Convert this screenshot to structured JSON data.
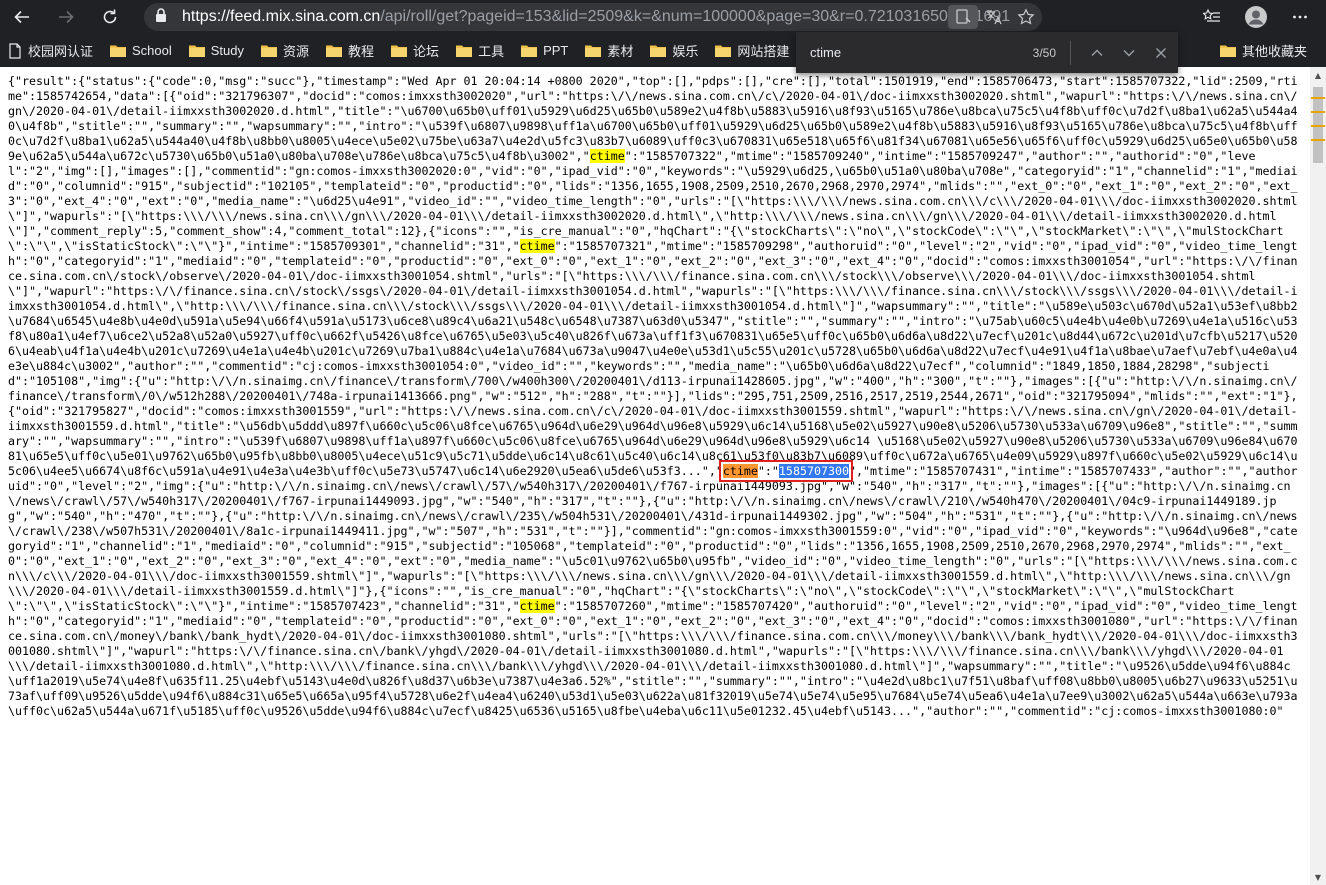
{
  "browser": {
    "url_base": "https://feed.mix.sina.com.cn",
    "url_rest": "/api/roll/get?pageid=153&lid=2509&k=&num=100000&page=30&r=0.7210316507361691"
  },
  "bookmarks": {
    "items": [
      {
        "label": "校园网认证",
        "icon": "page-icon"
      },
      {
        "label": "School",
        "icon": "folder-icon"
      },
      {
        "label": "Study",
        "icon": "folder-icon"
      },
      {
        "label": "资源",
        "icon": "folder-icon"
      },
      {
        "label": "教程",
        "icon": "folder-icon"
      },
      {
        "label": "论坛",
        "icon": "folder-icon"
      },
      {
        "label": "工具",
        "icon": "folder-icon"
      },
      {
        "label": "PPT",
        "icon": "folder-icon"
      },
      {
        "label": "素材",
        "icon": "folder-icon"
      },
      {
        "label": "娱乐",
        "icon": "folder-icon"
      },
      {
        "label": "网站搭建",
        "icon": "folder-icon"
      }
    ],
    "other": "其他收藏夹"
  },
  "find": {
    "query": "ctime",
    "count": "3/50"
  },
  "content": {
    "segments": [
      {
        "t": "{\"result\":{\"status\":{\"code\":0,\"msg\":\"succ\"},\"timestamp\":\"Wed Apr 01 20:04:14 +0800 2020\",\"top\":[],\"pdps\":[],\"cre\":[],\"total\":1501919,\"end\":1585706473,\"start\":1585707322,\"lid\":2509,\"rtime\":1585742654,\"data\":[{\"oid\":\"321796307\",\"docid\":\"comos:imxxsth3002020\",\"url\":\"https:\\/\\/news.sina.com.cn\\/c\\/2020-04-01\\/doc-iimxxsth3002020.shtml\",\"wapurl\":\"https:\\/\\/news.sina.cn\\/gn\\/2020-04-01\\/detail-iimxxsth3002020.d.html\",\"title\":\"\\u6700\\u65b0\\uff01\\u5929\\u6d25\\u65b0\\u589e2\\u4f8b\\u5883\\u5916\\u8f93\\u5165\\u786e\\u8bca\\u75c5\\u4f8b\\uff0c\\u7d2f\\u8ba1\\u62a5\\u544a40\\u4f8b\",\"stitle\":\"\",\"summary\":\"\",\"wapsummary\":\"\",\"intro\":\"\\u539f\\u6807\\u9898\\uff1a\\u6700\\u65b0\\uff01\\u5929\\u6d25\\u65b0\\u589e2\\u4f8b\\u5883\\u5916\\u8f93\\u5165\\u786e\\u8bca\\u75c5\\u4f8b\\uff0c\\u7d2f\\u8ba1\\u62a5\\u544a40\\u4f8b\\u8bb0\\u8005\\u4ece\\u5e02\\u75be\\u63a7\\u4e2d\\u5fc3\\u83b7\\u6089\\uff0c3\\u670831\\u65e518\\u65f6\\u81f34\\u67081\\u65e56\\u65f6\\uff0c\\u5929\\u6d25\\u65e0\\u65b0\\u589e\\u62a5\\u544a\\u672c\\u5730\\u65b0\\u51a0\\u80ba\\u708e\\u786e\\u8bca\\u75c5\\u4f8b\\u3002\",\"",
        "k": "n"
      },
      {
        "t": "ctime",
        "k": "hl"
      },
      {
        "t": "\":\"1585707322\",\"mtime\":\"1585709240\",\"intime\":\"1585709247\",\"author\":\"\",\"authorid\":\"0\",\"level\":\"2\",\"img\":[],\"images\":[],\"commentid\":\"gn:comos-imxxsth3002020:0\",\"vid\":\"0\",\"ipad_vid\":\"0\",\"keywords\":\"\\u5929\\u6d25,\\u65b0\\u51a0\\u80ba\\u708e\",\"categoryid\":\"1\",\"channelid\":\"1\",\"mediaid\":\"0\",\"columnid\":\"915\",\"subjectid\":\"102105\",\"templateid\":\"0\",\"productid\":\"0\",\"lids\":\"1356,1655,1908,2509,2510,2670,2968,2970,2974\",\"mlids\":\"\",\"ext_0\":\"0\",\"ext_1\":\"0\",\"ext_2\":\"0\",\"ext_3\":\"0\",\"ext_4\":\"0\",\"ext\":\"0\",\"media_name\":\"\\u6d25\\u4e91\",\"video_id\":\"\",\"video_time_length\":\"0\",\"urls\":\"[\\\"https:\\\\\\/\\\\\\/news.sina.com.cn\\\\\\/c\\\\\\/2020-04-01\\\\\\/doc-iimxxsth3002020.shtml\\\"]\",\"wapurls\":\"[\\\"https:\\\\\\/\\\\\\/news.sina.cn\\\\\\/gn\\\\\\/2020-04-01\\\\\\/detail-iimxxsth3002020.d.html\\\",\\\"http:\\\\\\/\\\\\\/news.sina.cn\\\\\\/gn\\\\\\/2020-04-01\\\\\\/detail-iimxxsth3002020.d.html\\\"]\",\"comment_reply\":5,\"comment_show\":4,\"comment_total\":12},{\"icons\":\"\",\"is_cre_manual\":\"0\",\"hqChart\":\"{\\\"stockCharts\\\":\\\"no\\\",\\\"stockCode\\\":\\\"\\\",\\\"stockMarket\\\":\\\"\\\",\\\"mulStockChart\\\":\\\"\\\",\\\"isStaticStock\\\":\\\"\\\"}\",\"intime\":\"1585709301\",\"channelid\":\"31\",\"",
        "k": "n"
      },
      {
        "t": "ctime",
        "k": "hl"
      },
      {
        "t": "\":\"1585707321\",\"mtime\":\"1585709298\",\"authoruid\":\"0\",\"level\":\"2\",\"vid\":\"0\",\"ipad_vid\":\"0\",\"video_time_length\":\"0\",\"categoryid\":\"1\",\"mediaid\":\"0\",\"templateid\":\"0\",\"productid\":\"0\",\"ext_0\":\"0\",\"ext_1\":\"0\",\"ext_2\":\"0\",\"ext_3\":\"0\",\"ext_4\":\"0\",\"docid\":\"comos:imxxsth3001054\",\"url\":\"https:\\/\\/finance.sina.com.cn\\/stock\\/observe\\/2020-04-01\\/doc-iimxxsth3001054.shtml\",\"urls\":\"[\\\"https:\\\\\\/\\\\\\/finance.sina.com.cn\\\\\\/stock\\\\\\/observe\\\\\\/2020-04-01\\\\\\/doc-iimxxsth3001054.shtml\\\"]\",\"wapurl\":\"https:\\/\\/finance.sina.cn\\/stock\\/ssgs\\/2020-04-01\\/detail-iimxxsth3001054.d.html\",\"wapurls\":\"[\\\"https:\\\\\\/\\\\\\/finance.sina.cn\\\\\\/stock\\\\\\/ssgs\\\\\\/2020-04-01\\\\\\/detail-iimxxsth3001054.d.html\\\",\\\"http:\\\\\\/\\\\\\/finance.sina.cn\\\\\\/stock\\\\\\/ssgs\\\\\\/2020-04-01\\\\\\/detail-iimxxsth3001054.d.html\\\"]\",\"wapsummary\":\"\",\"title\":\"\\u589e\\u503c\\u670d\\u52a1\\u53ef\\u8bb2\\u7684\\u6545\\u4e8b\\u4e0d\\u591a\\u5e94\\u66f4\\u591a\\u5173\\u6ce8\\u89c4\\u6a21\\u548c\\u6548\\u7387\\u63d0\\u5347\",\"stitle\":\"\",\"summary\":\"\",\"intro\":\"\\u75ab\\u60c5\\u4e4b\\u4e0b\\u7269\\u4e1a\\u516c\\u53f8\\u80a1\\u4ef7\\u6ce2\\u52a8\\u52a0\\u5927\\uff0c\\u662f\\u5426\\u8fce\\u6765\\u5e03\\u5c40\\u826f\\u673a\\uff1f3\\u670831\\u65e5\\uff0c\\u65b0\\u6d6a\\u8d22\\u7ecf\\u201c\\u8d44\\u672c\\u201d\\u7cfb\\u5217\\u5206\\u4eab\\u4f1a\\u4e4b\\u201c\\u7269\\u4e1a\\u4e4b\\u201c\\u7269\\u7ba1\\u884c\\u4e1a\\u7684\\u673a\\u9047\\u4e0e\\u53d1\\u5c55\\u201c\\u5728\\u65b0\\u6d6a\\u8d22\\u7ecf\\u4e91\\u4f1a\\u8bae\\u7aef\\u7ebf\\u4e0a\\u4e3e\\u884c\\u3002\",\"author\":\"\",\"commentid\":\"cj:comos-imxxsth3001054:0\",\"video_id\":\"\",\"keywords\":\"\",\"media_name\":\"\\u65b0\\u6d6a\\u8d22\\u7ecf\",\"columnid\":\"1849,1850,1884,28298\",\"subjectid\":\"105108\",\"img\":{\"u\":\"http:\\/\\/n.sinaimg.cn\\/finance\\/transform\\/700\\/w400h300\\/20200401\\/d113-irpunai1428605.jpg\",\"w\":\"400\",\"h\":\"300\",\"t\":\"\"},\"images\":[{\"u\":\"http:\\/\\/n.sinaimg.cn\\/finance\\/transform\\/0\\/w512h288\\/20200401\\/748a-irpunai1413666.png\",\"w\":\"512\",\"h\":\"288\",\"t\":\"\"}],\"lids\":\"295,751,2509,2516,2517,2519,2544,2671\",\"oid\":\"321795094\",\"mlids\":\"\",\"ext\":\"1\"},{\"oid\":\"321795827\",\"docid\":\"comos:imxxsth3001559\",\"url\":\"https:\\/\\/news.sina.com.cn\\/c\\/2020-04-01\\/doc-iimxxsth3001559.shtml\",\"wapurl\":\"https:\\/\\/news.sina.cn\\/gn\\/2020-04-01\\/detail-iimxxsth3001559.d.html\",\"title\":\"\\u56db\\u5ddd\\u897f\\u660c\\u5c06\\u8fce\\u6765\\u964d\\u6e29\\u964d\\u96e8\\u5929\\u6c14\\u5168\\u5e02\\u5927\\u90e8\\u5206\\u5730\\u533a\\u6709\\u96e8\",\"stitle\":\"\",\"summary\":\"\",\"wapsummary\":\"\",\"intro\":\"\\u539f\\u6807\\u9898\\uff1a\\u897f\\u660c\\u5c06\\u8fce\\u6765\\u964d\\u6e29\\u964d\\u96e8\\u5929\\u6c14 \\u5168\\u5e02\\u5927\\u90e8\\u5206\\u5730\\u533a\\u6709\\u96e84\\u67081\\u65e5\\uff0c\\u5e01\\u9762\\u65b0\\u95fb\\u8bb0\\u8005\\u4ece\\u51c9\\u5c71\\u5dde\\u6c14\\u8c61\\u5c40\\u6c14\\u8c61\\u53f0\\u83b7\\u6089\\uff0c\\u672a\\u6765\\u4e09\\u5929\\u897f\\u660c\\u5e02\\u5929\\u6c14\\u5c06\\u4ee5\\u6674\\u8f6c\\u591a\\u4e91\\u4e3a\\u4e3b\\uff0c\\u5e73\\u5747\\u6c14\\u6e2920\\u5ea6\\u5de6\\u53f3...\",\"",
        "k": "n"
      },
      {
        "t": "ctime",
        "k": "cur"
      },
      {
        "t": "\":\"",
        "k": "box"
      },
      {
        "t": "1585707300",
        "k": "sel"
      },
      {
        "t": "\",\"mtime\":\"1585707431\",\"intime\":\"1585707433\",\"author\":\"\",\"authoruid\":\"0\",\"level\":\"2\",\"img\":{\"u\":\"http:\\/\\/n.sinaimg.cn\\/news\\/crawl\\/57\\/w540h317\\/20200401\\/f767-irpunai1449093.jpg\",\"w\":\"540\",\"h\":\"317\",\"t\":\"\"},\"images\":[{\"u\":\"http:\\/\\/n.sinaimg.cn\\/news\\/crawl\\/57\\/w540h317\\/20200401\\/f767-irpunai1449093.jpg\",\"w\":\"540\",\"h\":\"317\",\"t\":\"\"},{\"u\":\"http:\\/\\/n.sinaimg.cn\\/news\\/crawl\\/210\\/w540h470\\/20200401\\/04c9-irpunai1449189.jpg\",\"w\":\"540\",\"h\":\"470\",\"t\":\"\"},{\"u\":\"http:\\/\\/n.sinaimg.cn\\/news\\/crawl\\/235\\/w504h531\\/20200401\\/431d-irpunai1449302.jpg\",\"w\":\"504\",\"h\":\"531\",\"t\":\"\"},{\"u\":\"http:\\/\\/n.sinaimg.cn\\/news\\/crawl\\/238\\/w507h531\\/20200401\\/8a1c-irpunai1449411.jpg\",\"w\":\"507\",\"h\":\"531\",\"t\":\"\"}],\"commentid\":\"gn:comos-imxxsth3001559:0\",\"vid\":\"0\",\"ipad_vid\":\"0\",\"keywords\":\"\\u964d\\u96e8\",\"categoryid\":\"1\",\"channelid\":\"1\",\"mediaid\":\"0\",\"columnid\":\"915\",\"subjectid\":\"105068\",\"templateid\":\"0\",\"productid\":\"0\",\"lids\":\"1356,1655,1908,2509,2510,2670,2968,2970,2974\",\"mlids\":\"\",\"ext_0\":\"0\",\"ext_1\":\"0\",\"ext_2\":\"0\",\"ext_3\":\"0\",\"ext_4\":\"0\",\"ext\":\"0\",\"media_name\":\"\\u5c01\\u9762\\u65b0\\u95fb\",\"video_id\":\"0\",\"video_time_length\":\"0\",\"urls\":\"[\\\"https:\\\\\\/\\\\\\/news.sina.com.cn\\\\\\/c\\\\\\/2020-04-01\\\\\\/doc-iimxxsth3001559.shtml\\\"]\",\"wapurls\":\"[\\\"https:\\\\\\/\\\\\\/news.sina.cn\\\\\\/gn\\\\\\/2020-04-01\\\\\\/detail-iimxxsth3001559.d.html\\\",\\\"http:\\\\\\/\\\\\\/news.sina.cn\\\\\\/gn\\\\\\/2020-04-01\\\\\\/detail-iimxxsth3001559.d.html\\\"]\"},{\"icons\":\"\",\"is_cre_manual\":\"0\",\"hqChart\":\"{\\\"stockCharts\\\":\\\"no\\\",\\\"stockCode\\\":\\\"\\\",\\\"stockMarket\\\":\\\"\\\",\\\"mulStockChart\\\":\\\"\\\",\\\"isStaticStock\\\":\\\"\\\"}\",\"intime\":\"1585707423\",\"channelid\":\"31\",\"",
        "k": "n"
      },
      {
        "t": "ctime",
        "k": "hl"
      },
      {
        "t": "\":\"1585707260\",\"mtime\":\"1585707420\",\"authoruid\":\"0\",\"level\":\"2\",\"vid\":\"0\",\"ipad_vid\":\"0\",\"video_time_length\":\"0\",\"categoryid\":\"1\",\"mediaid\":\"0\",\"templateid\":\"0\",\"productid\":\"0\",\"ext_0\":\"0\",\"ext_1\":\"0\",\"ext_2\":\"0\",\"ext_3\":\"0\",\"ext_4\":\"0\",\"docid\":\"comos:imxxsth3001080\",\"url\":\"https:\\/\\/finance.sina.com.cn\\/money\\/bank\\/bank_hydt\\/2020-04-01\\/doc-iimxxsth3001080.shtml\",\"urls\":\"[\\\"https:\\\\\\/\\\\\\/finance.sina.com.cn\\\\\\/money\\\\\\/bank\\\\\\/bank_hydt\\\\\\/2020-04-01\\\\\\/doc-iimxxsth3001080.shtml\\\"]\",\"wapurl\":\"https:\\/\\/finance.sina.cn\\/bank\\/yhgd\\/2020-04-01\\/detail-iimxxsth3001080.d.html\",\"wapurls\":\"[\\\"https:\\\\\\/\\\\\\/finance.sina.cn\\\\\\/bank\\\\\\/yhgd\\\\\\/2020-04-01\\\\\\/detail-iimxxsth3001080.d.html\\\",\\\"http:\\\\\\/\\\\\\/finance.sina.cn\\\\\\/bank\\\\\\/yhgd\\\\\\/2020-04-01\\\\\\/detail-iimxxsth3001080.d.html\\\"]\",\"wapsummary\":\"\",\"title\":\"\\u9526\\u5dde\\u94f6\\u884c\\uff1a2019\\u5e74\\u4e8f\\u635f11.25\\u4ebf\\u5143\\u4e0d\\u826f\\u8d37\\u6b3e\\u7387\\u4e3a6.52%\",\"stitle\":\"\",\"summary\":\"\",\"intro\":\"\\u4e2d\\u8bc1\\u7f51\\u8baf\\uff08\\u8bb0\\u8005\\u6b27\\u9633\\u5251\\u73af\\uff09\\u9526\\u5dde\\u94f6\\u884c31\\u65e5\\u665a\\u95f4\\u5728\\u6e2f\\u4ea4\\u6240\\u53d1\\u5e03\\u622a\\u81f32019\\u5e74\\u5e74\\u5e95\\u7684\\u5e74\\u5ea6\\u4e1a\\u7ee9\\u3002\\u62a5\\u544a\\u663e\\u793a\\uff0c\\u62a5\\u544a\\u671f\\u5185\\uff0c\\u9526\\u5dde\\u94f6\\u884c\\u7ecf\\u8425\\u6536\\u5165\\u8fbe\\u4eba\\u6c11\\u5e01232.45\\u4ebf\\u5143...\",\"author\":\"\",\"commentid\":\"cj:comos-imxxsth3001080:0\"",
        "k": "n"
      }
    ]
  }
}
